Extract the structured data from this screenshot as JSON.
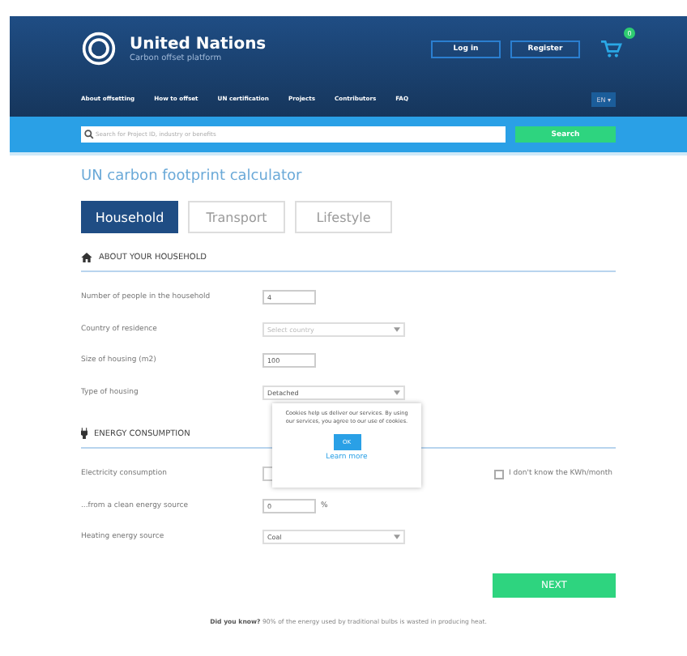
{
  "brand": {
    "title": "United Nations",
    "subtitle": "Carbon offset platform"
  },
  "header_buttons": [
    "Log in",
    "Register"
  ],
  "cart": {
    "count": "0"
  },
  "nav": [
    "About offsetting",
    "How to offset",
    "UN certification",
    "Projects",
    "Contributors",
    "FAQ"
  ],
  "language": "EN ▾",
  "search": {
    "placeholder": "Search for Project ID, industry or benefits",
    "button": "Search"
  },
  "page_title": "UN carbon footprint calculator",
  "tabs": [
    {
      "label": "Household",
      "selected": true
    },
    {
      "label": "Transport",
      "selected": false
    },
    {
      "label": "Lifestyle",
      "selected": false
    }
  ],
  "sections": [
    {
      "title": "ABOUT YOUR HOUSEHOLD",
      "fields": [
        {
          "label": "Number of people in the household",
          "kind": "input",
          "value": "4"
        },
        {
          "label": "Country of residence",
          "kind": "select",
          "placeholder": "Select country"
        },
        {
          "label": "Size of housing (m2)",
          "kind": "input",
          "value": "100"
        },
        {
          "label": "Type of housing",
          "kind": "select",
          "value": "Detached"
        }
      ]
    },
    {
      "title": "ENERGY CONSUMPTION",
      "fields": [
        {
          "label": "Electricity consumption",
          "kind": "input-check",
          "check_label": "I don't know the KWh/month",
          "checked": false
        },
        {
          "label": "...from a clean energy source",
          "kind": "input",
          "value": "0",
          "unit": "%"
        },
        {
          "label": "Heating energy source",
          "kind": "select",
          "value": "Coal"
        }
      ]
    }
  ],
  "next_button": "NEXT",
  "tip": {
    "lead": "Did you know?",
    "text": "90% of the energy used by traditional bulbs is wasted in producing heat."
  },
  "cookie": {
    "text": "Cookies help us deliver our services. By using our services, you agree to our use of cookies.",
    "ok": "OK",
    "link": "Learn more"
  }
}
